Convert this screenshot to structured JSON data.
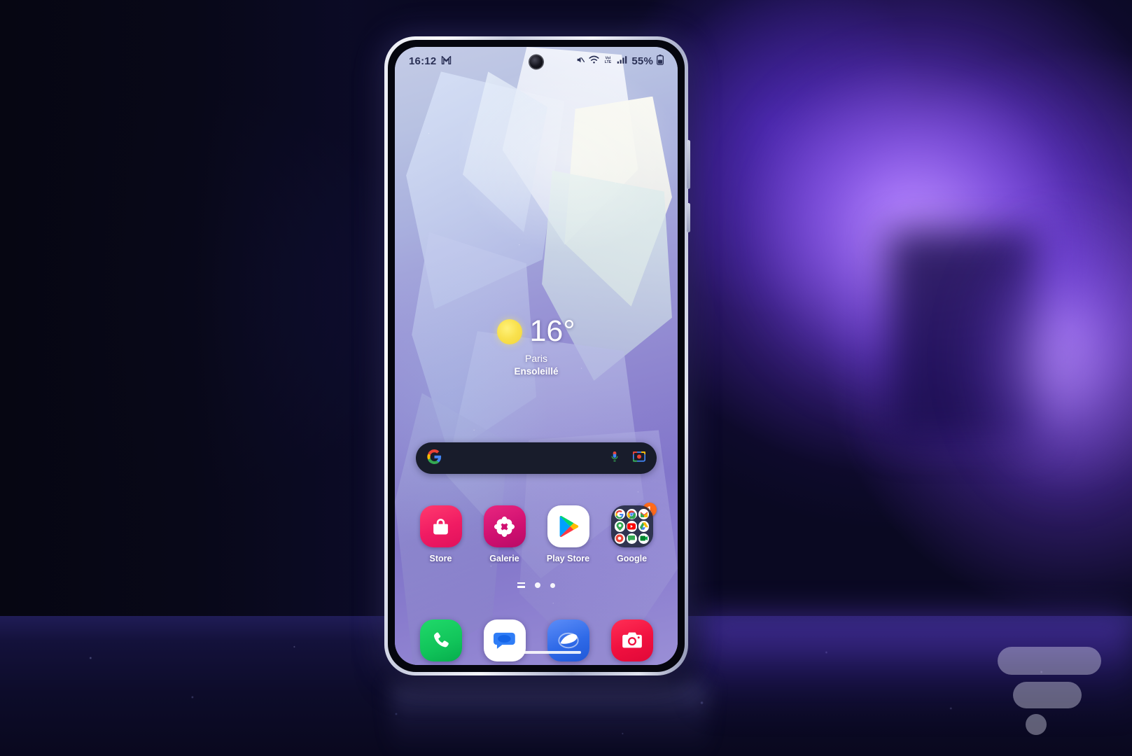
{
  "scene": {
    "device": "smartphone-on-table",
    "colors": {
      "frame": "#e8eaf2",
      "accent_purple": "#7b50e8",
      "background_dark": "#0a0a18",
      "badge_orange": "#ff6a1a",
      "dock_green": "#11c45a",
      "dock_red": "#f0103f",
      "dock_blue": "#2f6ae8"
    }
  },
  "status_bar": {
    "time": "16:12",
    "left_icons": [
      {
        "name": "gmail-icon",
        "glyph": "M"
      }
    ],
    "right_icons": [
      {
        "name": "mute-icon",
        "glyph": "mute"
      },
      {
        "name": "wifi-icon",
        "glyph": "wifi"
      },
      {
        "name": "volte-icon",
        "glyph": "VoLTE"
      },
      {
        "name": "signal-icon",
        "glyph": "signal"
      }
    ],
    "battery_percent": "55%",
    "battery_icon": "battery-icon"
  },
  "weather_widget": {
    "icon": "sun-icon",
    "temperature": "16°",
    "city": "Paris",
    "condition": "Ensoleillé"
  },
  "search_bar": {
    "logo": "google-g-icon",
    "placeholder": "",
    "value": "",
    "mic_icon": "microphone-icon",
    "lens_icon": "google-lens-icon"
  },
  "app_grid": [
    {
      "label": "Store",
      "icon": "galaxy-store-icon"
    },
    {
      "label": "Galerie",
      "icon": "gallery-icon"
    },
    {
      "label": "Play Store",
      "icon": "play-store-icon"
    },
    {
      "label": "Google",
      "icon": "google-folder-icon",
      "badge": "1",
      "folder_apps": [
        "Google",
        "Chrome",
        "Gmail",
        "Maps",
        "YouTube",
        "Drive",
        "Photos",
        "Messages",
        "Meet"
      ]
    }
  ],
  "page_indicator": {
    "dots": [
      "apps-list",
      "home",
      "page-2"
    ],
    "active_index": 1
  },
  "dock": [
    {
      "label": "Phone",
      "icon": "phone-icon"
    },
    {
      "label": "Messages",
      "icon": "messages-icon"
    },
    {
      "label": "Samsung Internet",
      "icon": "browser-icon"
    },
    {
      "label": "Camera",
      "icon": "camera-icon"
    }
  ],
  "gesture_bar": {
    "name": "navigation-gesture-bar"
  },
  "watermark": {
    "name": "frandroid-logo"
  }
}
